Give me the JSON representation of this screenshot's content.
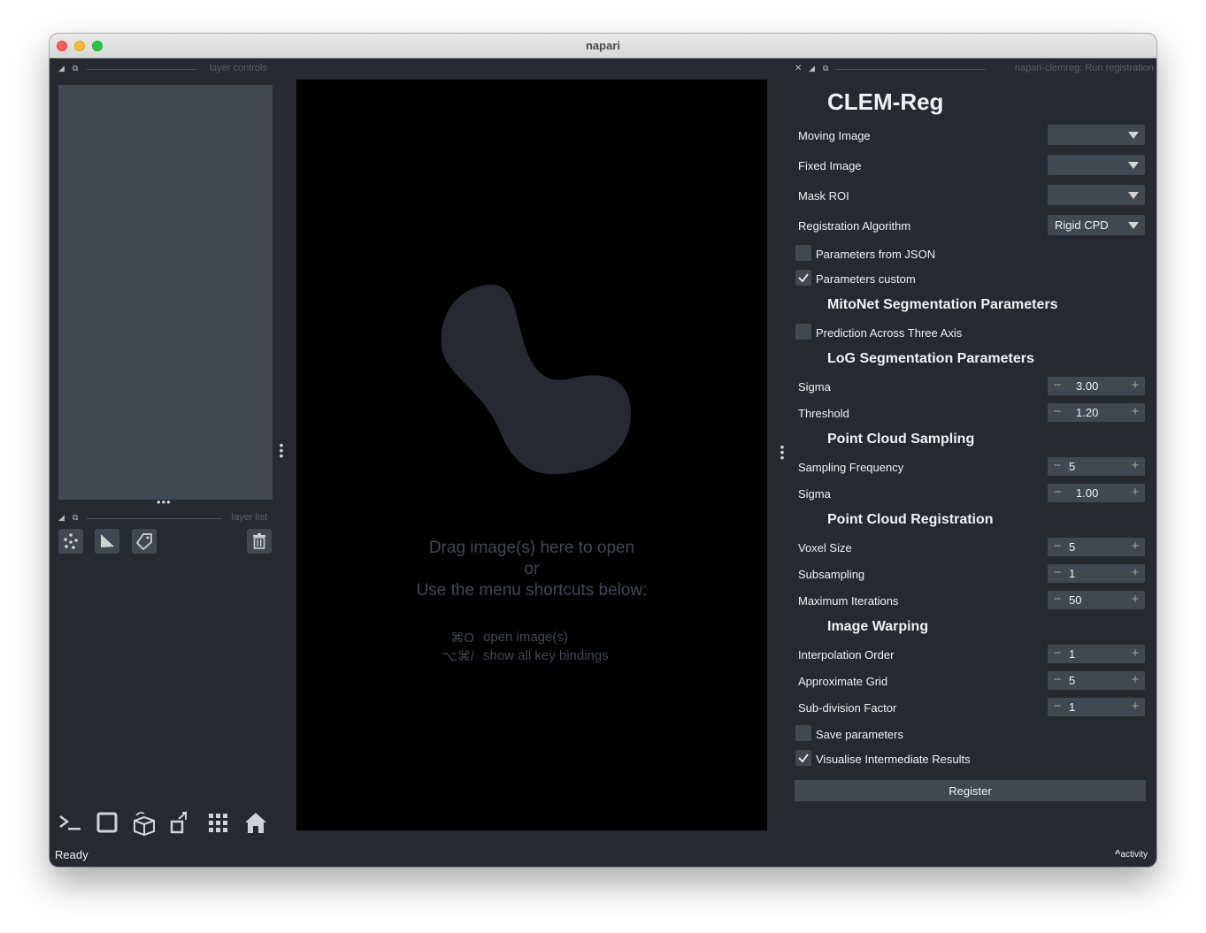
{
  "window": {
    "title": "napari"
  },
  "left": {
    "controls_header": "layer controls",
    "list_header": "layer list"
  },
  "canvas": {
    "welcome_lines": [
      "Drag image(s) here to open",
      "or",
      "Use the menu shortcuts below:"
    ],
    "shortcuts": [
      {
        "key": "⌘O",
        "desc": "open image(s)"
      },
      {
        "key": "⌥⌘/",
        "desc": "show all key bindings"
      }
    ]
  },
  "panel": {
    "header": "napari-clemreg: Run registration",
    "title": "CLEM-Reg",
    "moving_image": {
      "label": "Moving Image",
      "value": ""
    },
    "fixed_image": {
      "label": "Fixed Image",
      "value": ""
    },
    "mask_roi": {
      "label": "Mask ROI",
      "value": ""
    },
    "algorithm": {
      "label": "Registration Algorithm",
      "value": "Rigid CPD"
    },
    "params_json": {
      "label": "Parameters from JSON",
      "checked": false
    },
    "params_custom": {
      "label": "Parameters custom",
      "checked": true
    },
    "sec_mitonet": "MitoNet Segmentation Parameters",
    "three_axis": {
      "label": "Prediction Across Three Axis",
      "checked": false
    },
    "sec_log": "LoG Segmentation Parameters",
    "log_sigma": {
      "label": "Sigma",
      "value": "3.00"
    },
    "log_threshold": {
      "label": "Threshold",
      "value": "1.20"
    },
    "sec_sampling": "Point Cloud Sampling",
    "sampling_freq": {
      "label": "Sampling Frequency",
      "value": "5"
    },
    "sampling_sigma": {
      "label": "Sigma",
      "value": "1.00"
    },
    "sec_registration": "Point Cloud Registration",
    "voxel_size": {
      "label": "Voxel Size",
      "value": "5"
    },
    "subsampling": {
      "label": "Subsampling",
      "value": "1"
    },
    "max_iter": {
      "label": "Maximum Iterations",
      "value": "50"
    },
    "sec_warping": "Image Warping",
    "interp_order": {
      "label": "Interpolation Order",
      "value": "1"
    },
    "approx_grid": {
      "label": "Approximate Grid",
      "value": "5"
    },
    "subdiv": {
      "label": "Sub-division Factor",
      "value": "1"
    },
    "save_params": {
      "label": "Save parameters",
      "checked": false
    },
    "visualise": {
      "label": "Visualise Intermediate Results",
      "checked": true
    },
    "register_label": "Register"
  },
  "status": {
    "text": "Ready",
    "activity": "activity"
  },
  "icons": {
    "points": "points-icon",
    "shapes": "shapes-icon",
    "labels": "labels-icon",
    "delete": "trash-icon",
    "console": "console-icon",
    "ndisplay": "square-icon",
    "roll": "cube-icon",
    "transpose": "transpose-icon",
    "grid": "grid-icon",
    "home": "home-icon"
  }
}
